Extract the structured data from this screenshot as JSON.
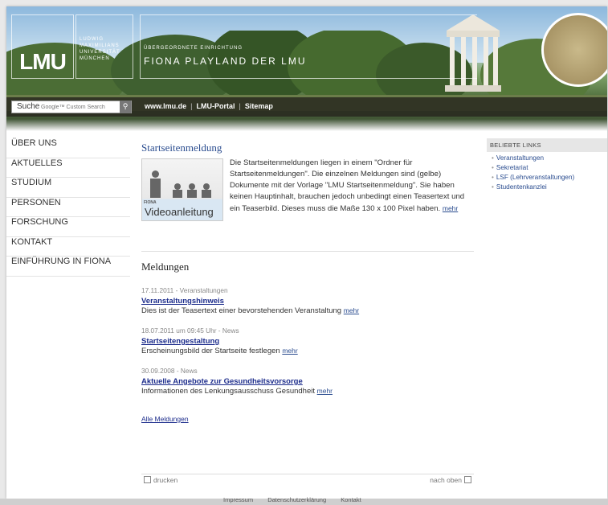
{
  "header": {
    "logo": "LMU",
    "university_lines": [
      "LUDWIG",
      "MAXIMILIANS",
      "UNIVERSITÄT",
      "MÜNCHEN"
    ],
    "site_subtitle": "ÜBERGEORDNETE EINRICHTUNG",
    "site_title": "FIONA PLAYLAND DER LMU"
  },
  "toolbar": {
    "search_label": "Suche",
    "search_placeholder": "Google™ Custom Search",
    "links": [
      "www.lmu.de",
      "LMU-Portal",
      "Sitemap"
    ]
  },
  "nav": {
    "items": [
      "ÜBER UNS",
      "AKTUELLES",
      "STUDIUM",
      "PERSONEN",
      "FORSCHUNG",
      "KONTAKT",
      "EINFÜHRUNG IN FIONA"
    ]
  },
  "main": {
    "start_heading": "Startseitenmeldung",
    "teaser_img_label": "FIONA",
    "teaser_img_text": "Videoanleitung",
    "teaser_text": "Die Startseitenmeldungen liegen in einem \"Ordner für Startseitenmeldungen\". Die einzelnen Meldungen sind (gelbe) Dokumente mit der Vorlage \"LMU Startseitenmeldung\". Sie haben keinen Hauptinhalt, brauchen jedoch unbedingt einen Teasertext und ein Teaserbild. Dieses muss die Maße 130 x 100 Pixel haben.",
    "mehr": "mehr",
    "news_heading": "Meldungen",
    "news": [
      {
        "meta": "17.11.2011 - Veranstaltungen",
        "title": "Veranstaltungshinweis",
        "text": "Dies ist der Teasertext einer bevorstehenden Veranstaltung"
      },
      {
        "meta": "18.07.2011 um 09:45 Uhr - News",
        "title": "Startseitengestaltung",
        "text": "Erscheinungsbild der Startseite festlegen"
      },
      {
        "meta": "30.09.2008 - News",
        "title": "Aktuelle Angebote zur Gesundheitsvorsorge",
        "text": "Informationen des Lenkungsausschuss Gesundheit"
      }
    ],
    "all_news": "Alle Meldungen",
    "print": "drucken",
    "to_top": "nach oben"
  },
  "side": {
    "heading": "BELIEBTE LINKS",
    "items": [
      "Veranstaltungen",
      "Sekretariat",
      "LSF (Lehrveranstaltungen)",
      "Studentenkanzlei"
    ]
  },
  "footer": {
    "links": [
      "Impressum",
      "Datenschutzerklärung",
      "Kontakt"
    ]
  }
}
